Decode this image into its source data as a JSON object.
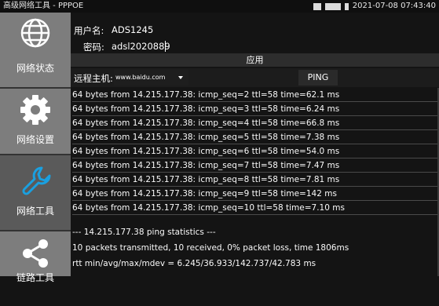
{
  "status_bar": {
    "title": "高级网络工具 - PPPOE",
    "datetime": "2021-07-08 07:43:40",
    "icons": [
      "keyboard-icon",
      "network-icon",
      "battery-icon"
    ]
  },
  "sidebar": {
    "items": [
      {
        "label": "网络状态",
        "icon": "globe-icon"
      },
      {
        "label": "网络设置",
        "icon": "gear-icon"
      },
      {
        "label": "网络工具",
        "icon": "wrench-icon"
      },
      {
        "label": "链路工具",
        "icon": "share-icon"
      }
    ],
    "active_index": 2
  },
  "form": {
    "username_label": "用户名:",
    "username_value": "ADS1245",
    "password_label": "密码:",
    "password_value": "adsl2020889",
    "apply_label": "应用"
  },
  "remote_host": {
    "label": "远程主机:",
    "value": "www.baidu.com",
    "ping_label": "PING"
  },
  "results": {
    "lines": [
      "64 bytes from 14.215.177.38: icmp_seq=2 ttl=58 time=62.1 ms",
      "64 bytes from 14.215.177.38: icmp_seq=3 ttl=58 time=6.24 ms",
      "64 bytes from 14.215.177.38: icmp_seq=4 ttl=58 time=66.8 ms",
      "64 bytes from 14.215.177.38: icmp_seq=5 ttl=58 time=7.38 ms",
      "64 bytes from 14.215.177.38: icmp_seq=6 ttl=58 time=54.0 ms",
      "64 bytes from 14.215.177.38: icmp_seq=7 ttl=58 time=7.47 ms",
      "64 bytes from 14.215.177.38: icmp_seq=8 ttl=58 time=7.81 ms",
      "64 bytes from 14.215.177.38: icmp_seq=9 ttl=58 time=142 ms",
      "64 bytes from 14.215.177.38: icmp_seq=10 ttl=58 time=7.10 ms"
    ],
    "stats": [
      "--- 14.215.177.38 ping statistics ---",
      "10 packets transmitted, 10 received, 0% packet loss, time 1806ms",
      "rtt min/avg/max/mdev = 6.245/36.933/142.737/42.783 ms"
    ]
  },
  "colors": {
    "background": "#141414",
    "sidebar": "#7d7d7d",
    "sidebar_active": "#5a5a5a",
    "wrench_accent": "#1aa0e0"
  }
}
